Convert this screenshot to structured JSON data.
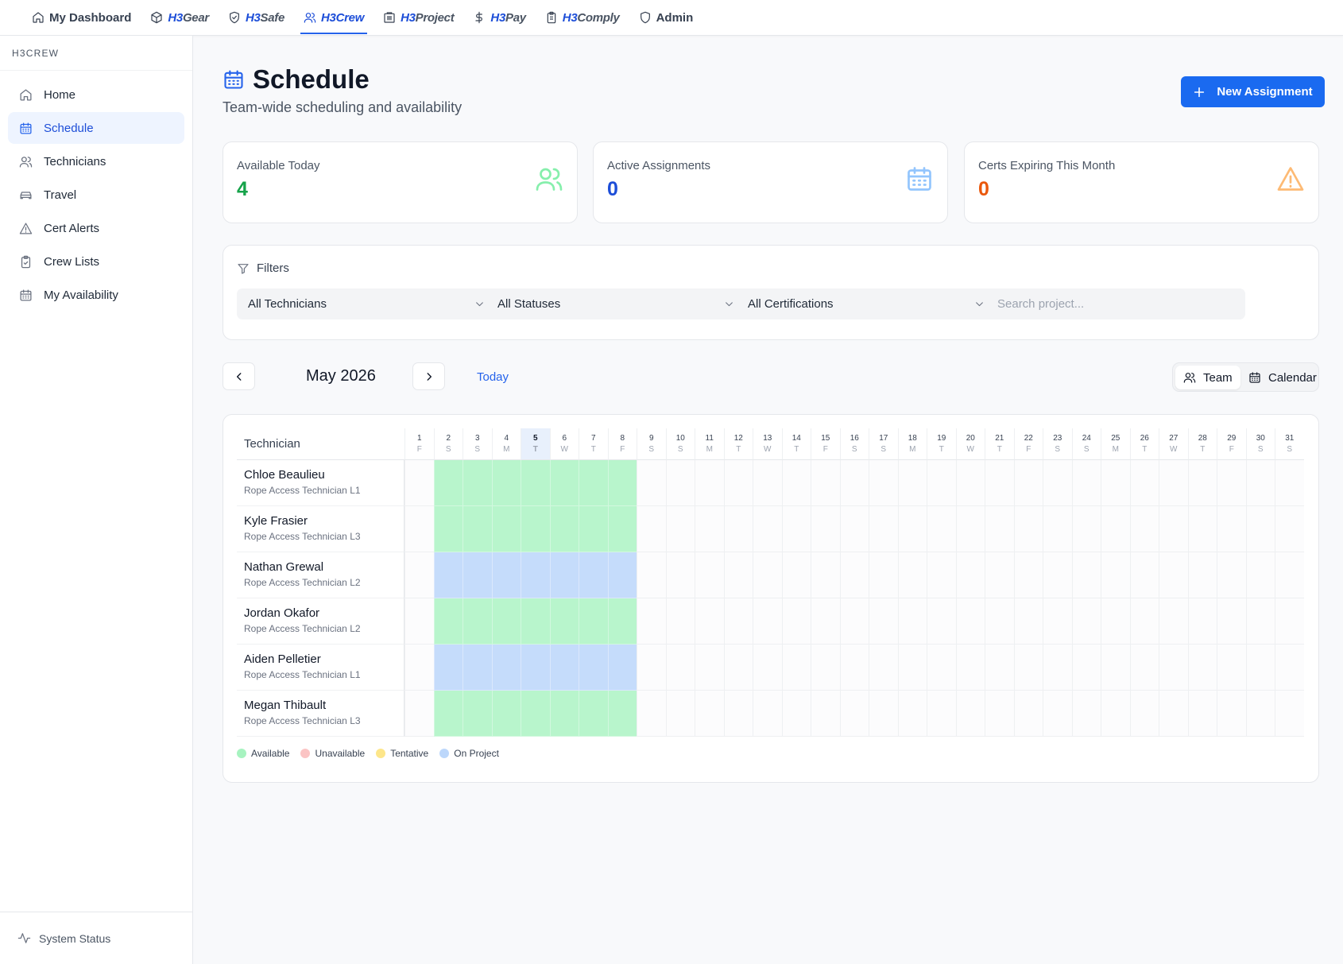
{
  "topnav": {
    "items": [
      {
        "label": "My Dashboard",
        "icon": "home-icon",
        "kind": "plain"
      },
      {
        "h3": "H3",
        "rest": "Gear",
        "icon": "box-icon",
        "kind": "brand"
      },
      {
        "h3": "H3",
        "rest": "Safe",
        "icon": "shield-check-icon",
        "kind": "brand"
      },
      {
        "h3": "H3",
        "rest": "Crew",
        "icon": "users-icon",
        "kind": "brand",
        "active": true
      },
      {
        "h3": "H3",
        "rest": "Project",
        "icon": "building-icon",
        "kind": "brand"
      },
      {
        "h3": "H3",
        "rest": "Pay",
        "icon": "dollar-icon",
        "kind": "brand"
      },
      {
        "h3": "H3",
        "rest": "Comply",
        "icon": "clipboard-icon",
        "kind": "brand"
      },
      {
        "label": "Admin",
        "icon": "shield-icon",
        "kind": "plain"
      }
    ]
  },
  "sidebar": {
    "section_title": "H3CREW",
    "items": [
      {
        "label": "Home",
        "icon": "home-icon"
      },
      {
        "label": "Schedule",
        "icon": "calendar-icon",
        "active": true
      },
      {
        "label": "Technicians",
        "icon": "users-icon"
      },
      {
        "label": "Travel",
        "icon": "car-icon"
      },
      {
        "label": "Cert Alerts",
        "icon": "alert-triangle-icon"
      },
      {
        "label": "Crew Lists",
        "icon": "clipboard-check-icon"
      },
      {
        "label": "My Availability",
        "icon": "calendar-icon"
      }
    ],
    "footer_label": "System Status"
  },
  "header": {
    "title": "Schedule",
    "subtitle": "Team-wide scheduling and availability",
    "new_button": "New Assignment"
  },
  "stats": [
    {
      "label": "Available Today",
      "value": "4",
      "color": "#16a34a",
      "icon": "users-icon",
      "icon_color": "#86efac"
    },
    {
      "label": "Active Assignments",
      "value": "0",
      "color": "#1d4ed8",
      "icon": "calendar-icon",
      "icon_color": "#93c5fd"
    },
    {
      "label": "Certs Expiring This Month",
      "value": "0",
      "color": "#ea580c",
      "icon": "alert-triangle-icon",
      "icon_color": "#fdba74"
    }
  ],
  "filters": {
    "title": "Filters",
    "technician": "All Technicians",
    "status": "All Statuses",
    "certification": "All Certifications",
    "search_placeholder": "Search project..."
  },
  "calendar": {
    "month_label": "May 2026",
    "today_label": "Today",
    "view_team": "Team",
    "view_calendar": "Calendar",
    "technician_col": "Technician",
    "today_day": 5,
    "days": [
      {
        "d": "1",
        "w": "F"
      },
      {
        "d": "2",
        "w": "S"
      },
      {
        "d": "3",
        "w": "S"
      },
      {
        "d": "4",
        "w": "M"
      },
      {
        "d": "5",
        "w": "T"
      },
      {
        "d": "6",
        "w": "W"
      },
      {
        "d": "7",
        "w": "T"
      },
      {
        "d": "8",
        "w": "F"
      },
      {
        "d": "9",
        "w": "S"
      },
      {
        "d": "10",
        "w": "S"
      },
      {
        "d": "11",
        "w": "M"
      },
      {
        "d": "12",
        "w": "T"
      },
      {
        "d": "13",
        "w": "W"
      },
      {
        "d": "14",
        "w": "T"
      },
      {
        "d": "15",
        "w": "F"
      },
      {
        "d": "16",
        "w": "S"
      },
      {
        "d": "17",
        "w": "S"
      },
      {
        "d": "18",
        "w": "M"
      },
      {
        "d": "19",
        "w": "T"
      },
      {
        "d": "20",
        "w": "W"
      },
      {
        "d": "21",
        "w": "T"
      },
      {
        "d": "22",
        "w": "F"
      },
      {
        "d": "23",
        "w": "S"
      },
      {
        "d": "24",
        "w": "S"
      },
      {
        "d": "25",
        "w": "M"
      },
      {
        "d": "26",
        "w": "T"
      },
      {
        "d": "27",
        "w": "W"
      },
      {
        "d": "28",
        "w": "T"
      },
      {
        "d": "29",
        "w": "F"
      },
      {
        "d": "30",
        "w": "S"
      },
      {
        "d": "31",
        "w": "S"
      }
    ],
    "technicians": [
      {
        "name": "Chloe Beaulieu",
        "role": "Rope Access Technician L1",
        "status": "available",
        "from": 2,
        "to": 8
      },
      {
        "name": "Kyle Frasier",
        "role": "Rope Access Technician L3",
        "status": "available",
        "from": 2,
        "to": 8
      },
      {
        "name": "Nathan Grewal",
        "role": "Rope Access Technician L2",
        "status": "on_project",
        "from": 2,
        "to": 8
      },
      {
        "name": "Jordan Okafor",
        "role": "Rope Access Technician L2",
        "status": "available",
        "from": 2,
        "to": 8
      },
      {
        "name": "Aiden Pelletier",
        "role": "Rope Access Technician L1",
        "status": "on_project",
        "from": 2,
        "to": 8
      },
      {
        "name": "Megan Thibault",
        "role": "Rope Access Technician L3",
        "status": "available",
        "from": 2,
        "to": 8
      }
    ],
    "legend": [
      {
        "label": "Available",
        "color": "#a7f3c0"
      },
      {
        "label": "Unavailable",
        "color": "#fbc4c4"
      },
      {
        "label": "Tentative",
        "color": "#fde68a"
      },
      {
        "label": "On Project",
        "color": "#bcd7fb"
      }
    ]
  }
}
